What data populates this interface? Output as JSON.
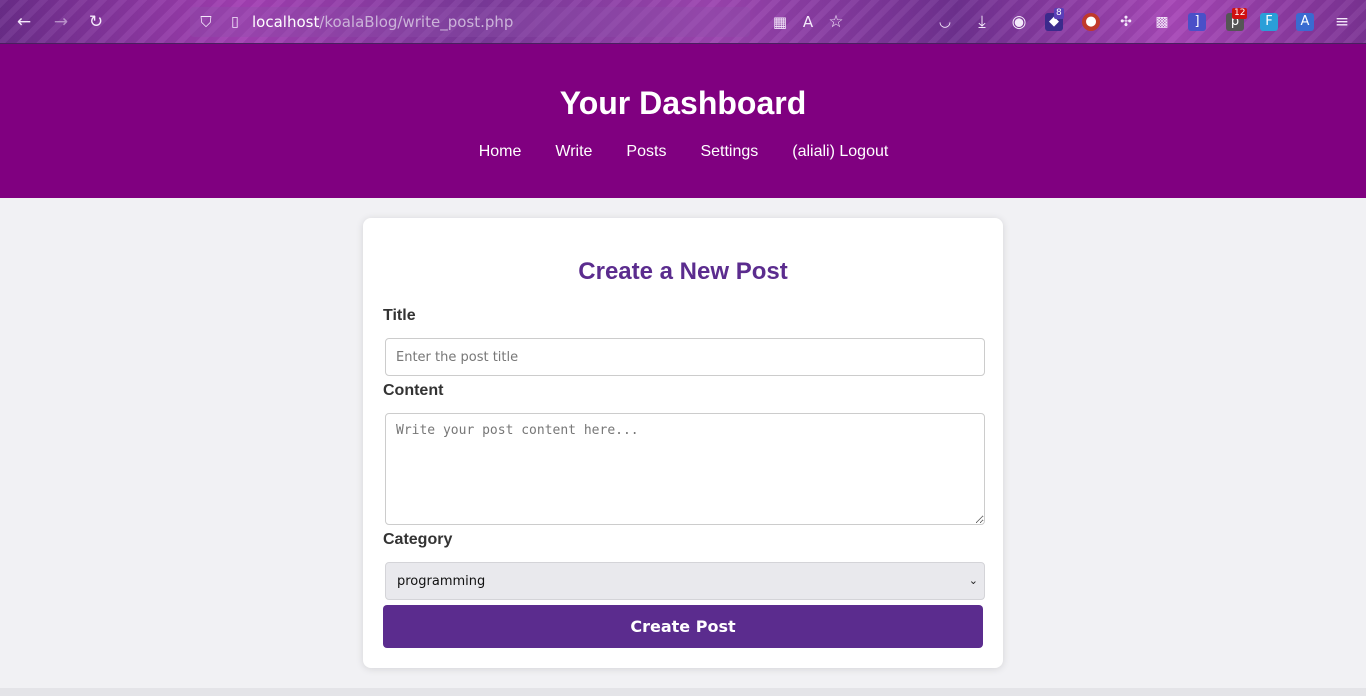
{
  "browser": {
    "url_host": "localhost",
    "url_path": "/koalaBlog/write_post.php",
    "ext_badge_1": "8",
    "ext_badge_2": "12"
  },
  "header": {
    "title": "Your Dashboard",
    "nav": [
      "Home",
      "Write",
      "Posts",
      "Settings",
      "(aliali) Logout"
    ]
  },
  "form": {
    "heading": "Create a New Post",
    "title_label": "Title",
    "title_placeholder": "Enter the post title",
    "content_label": "Content",
    "content_placeholder": "Write your post content here...",
    "category_label": "Category",
    "category_value": "programming",
    "submit_label": "Create Post"
  },
  "colors": {
    "header_bg": "#800080",
    "accent": "#5b2c8e",
    "page_bg": "#f1f1f4"
  }
}
